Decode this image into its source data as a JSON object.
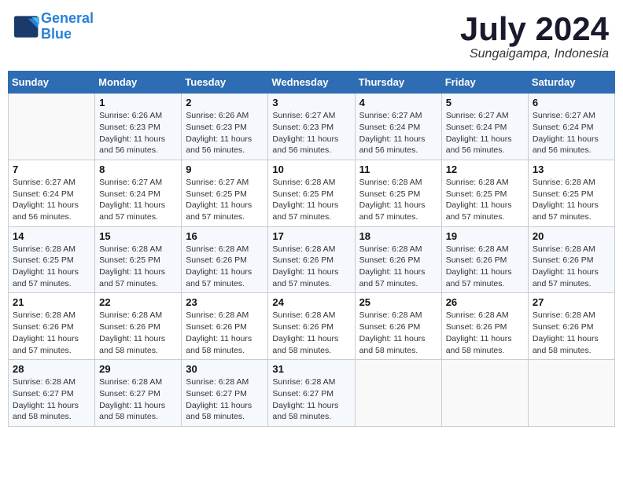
{
  "header": {
    "logo_line1": "General",
    "logo_line2": "Blue",
    "month": "July 2024",
    "location": "Sungaigampa, Indonesia"
  },
  "weekdays": [
    "Sunday",
    "Monday",
    "Tuesday",
    "Wednesday",
    "Thursday",
    "Friday",
    "Saturday"
  ],
  "weeks": [
    [
      {
        "num": "",
        "detail": ""
      },
      {
        "num": "1",
        "detail": "Sunrise: 6:26 AM\nSunset: 6:23 PM\nDaylight: 11 hours\nand 56 minutes."
      },
      {
        "num": "2",
        "detail": "Sunrise: 6:26 AM\nSunset: 6:23 PM\nDaylight: 11 hours\nand 56 minutes."
      },
      {
        "num": "3",
        "detail": "Sunrise: 6:27 AM\nSunset: 6:23 PM\nDaylight: 11 hours\nand 56 minutes."
      },
      {
        "num": "4",
        "detail": "Sunrise: 6:27 AM\nSunset: 6:24 PM\nDaylight: 11 hours\nand 56 minutes."
      },
      {
        "num": "5",
        "detail": "Sunrise: 6:27 AM\nSunset: 6:24 PM\nDaylight: 11 hours\nand 56 minutes."
      },
      {
        "num": "6",
        "detail": "Sunrise: 6:27 AM\nSunset: 6:24 PM\nDaylight: 11 hours\nand 56 minutes."
      }
    ],
    [
      {
        "num": "7",
        "detail": "Sunrise: 6:27 AM\nSunset: 6:24 PM\nDaylight: 11 hours\nand 56 minutes."
      },
      {
        "num": "8",
        "detail": "Sunrise: 6:27 AM\nSunset: 6:24 PM\nDaylight: 11 hours\nand 57 minutes."
      },
      {
        "num": "9",
        "detail": "Sunrise: 6:27 AM\nSunset: 6:25 PM\nDaylight: 11 hours\nand 57 minutes."
      },
      {
        "num": "10",
        "detail": "Sunrise: 6:28 AM\nSunset: 6:25 PM\nDaylight: 11 hours\nand 57 minutes."
      },
      {
        "num": "11",
        "detail": "Sunrise: 6:28 AM\nSunset: 6:25 PM\nDaylight: 11 hours\nand 57 minutes."
      },
      {
        "num": "12",
        "detail": "Sunrise: 6:28 AM\nSunset: 6:25 PM\nDaylight: 11 hours\nand 57 minutes."
      },
      {
        "num": "13",
        "detail": "Sunrise: 6:28 AM\nSunset: 6:25 PM\nDaylight: 11 hours\nand 57 minutes."
      }
    ],
    [
      {
        "num": "14",
        "detail": "Sunrise: 6:28 AM\nSunset: 6:25 PM\nDaylight: 11 hours\nand 57 minutes."
      },
      {
        "num": "15",
        "detail": "Sunrise: 6:28 AM\nSunset: 6:25 PM\nDaylight: 11 hours\nand 57 minutes."
      },
      {
        "num": "16",
        "detail": "Sunrise: 6:28 AM\nSunset: 6:26 PM\nDaylight: 11 hours\nand 57 minutes."
      },
      {
        "num": "17",
        "detail": "Sunrise: 6:28 AM\nSunset: 6:26 PM\nDaylight: 11 hours\nand 57 minutes."
      },
      {
        "num": "18",
        "detail": "Sunrise: 6:28 AM\nSunset: 6:26 PM\nDaylight: 11 hours\nand 57 minutes."
      },
      {
        "num": "19",
        "detail": "Sunrise: 6:28 AM\nSunset: 6:26 PM\nDaylight: 11 hours\nand 57 minutes."
      },
      {
        "num": "20",
        "detail": "Sunrise: 6:28 AM\nSunset: 6:26 PM\nDaylight: 11 hours\nand 57 minutes."
      }
    ],
    [
      {
        "num": "21",
        "detail": "Sunrise: 6:28 AM\nSunset: 6:26 PM\nDaylight: 11 hours\nand 57 minutes."
      },
      {
        "num": "22",
        "detail": "Sunrise: 6:28 AM\nSunset: 6:26 PM\nDaylight: 11 hours\nand 58 minutes."
      },
      {
        "num": "23",
        "detail": "Sunrise: 6:28 AM\nSunset: 6:26 PM\nDaylight: 11 hours\nand 58 minutes."
      },
      {
        "num": "24",
        "detail": "Sunrise: 6:28 AM\nSunset: 6:26 PM\nDaylight: 11 hours\nand 58 minutes."
      },
      {
        "num": "25",
        "detail": "Sunrise: 6:28 AM\nSunset: 6:26 PM\nDaylight: 11 hours\nand 58 minutes."
      },
      {
        "num": "26",
        "detail": "Sunrise: 6:28 AM\nSunset: 6:26 PM\nDaylight: 11 hours\nand 58 minutes."
      },
      {
        "num": "27",
        "detail": "Sunrise: 6:28 AM\nSunset: 6:26 PM\nDaylight: 11 hours\nand 58 minutes."
      }
    ],
    [
      {
        "num": "28",
        "detail": "Sunrise: 6:28 AM\nSunset: 6:27 PM\nDaylight: 11 hours\nand 58 minutes."
      },
      {
        "num": "29",
        "detail": "Sunrise: 6:28 AM\nSunset: 6:27 PM\nDaylight: 11 hours\nand 58 minutes."
      },
      {
        "num": "30",
        "detail": "Sunrise: 6:28 AM\nSunset: 6:27 PM\nDaylight: 11 hours\nand 58 minutes."
      },
      {
        "num": "31",
        "detail": "Sunrise: 6:28 AM\nSunset: 6:27 PM\nDaylight: 11 hours\nand 58 minutes."
      },
      {
        "num": "",
        "detail": ""
      },
      {
        "num": "",
        "detail": ""
      },
      {
        "num": "",
        "detail": ""
      }
    ]
  ]
}
